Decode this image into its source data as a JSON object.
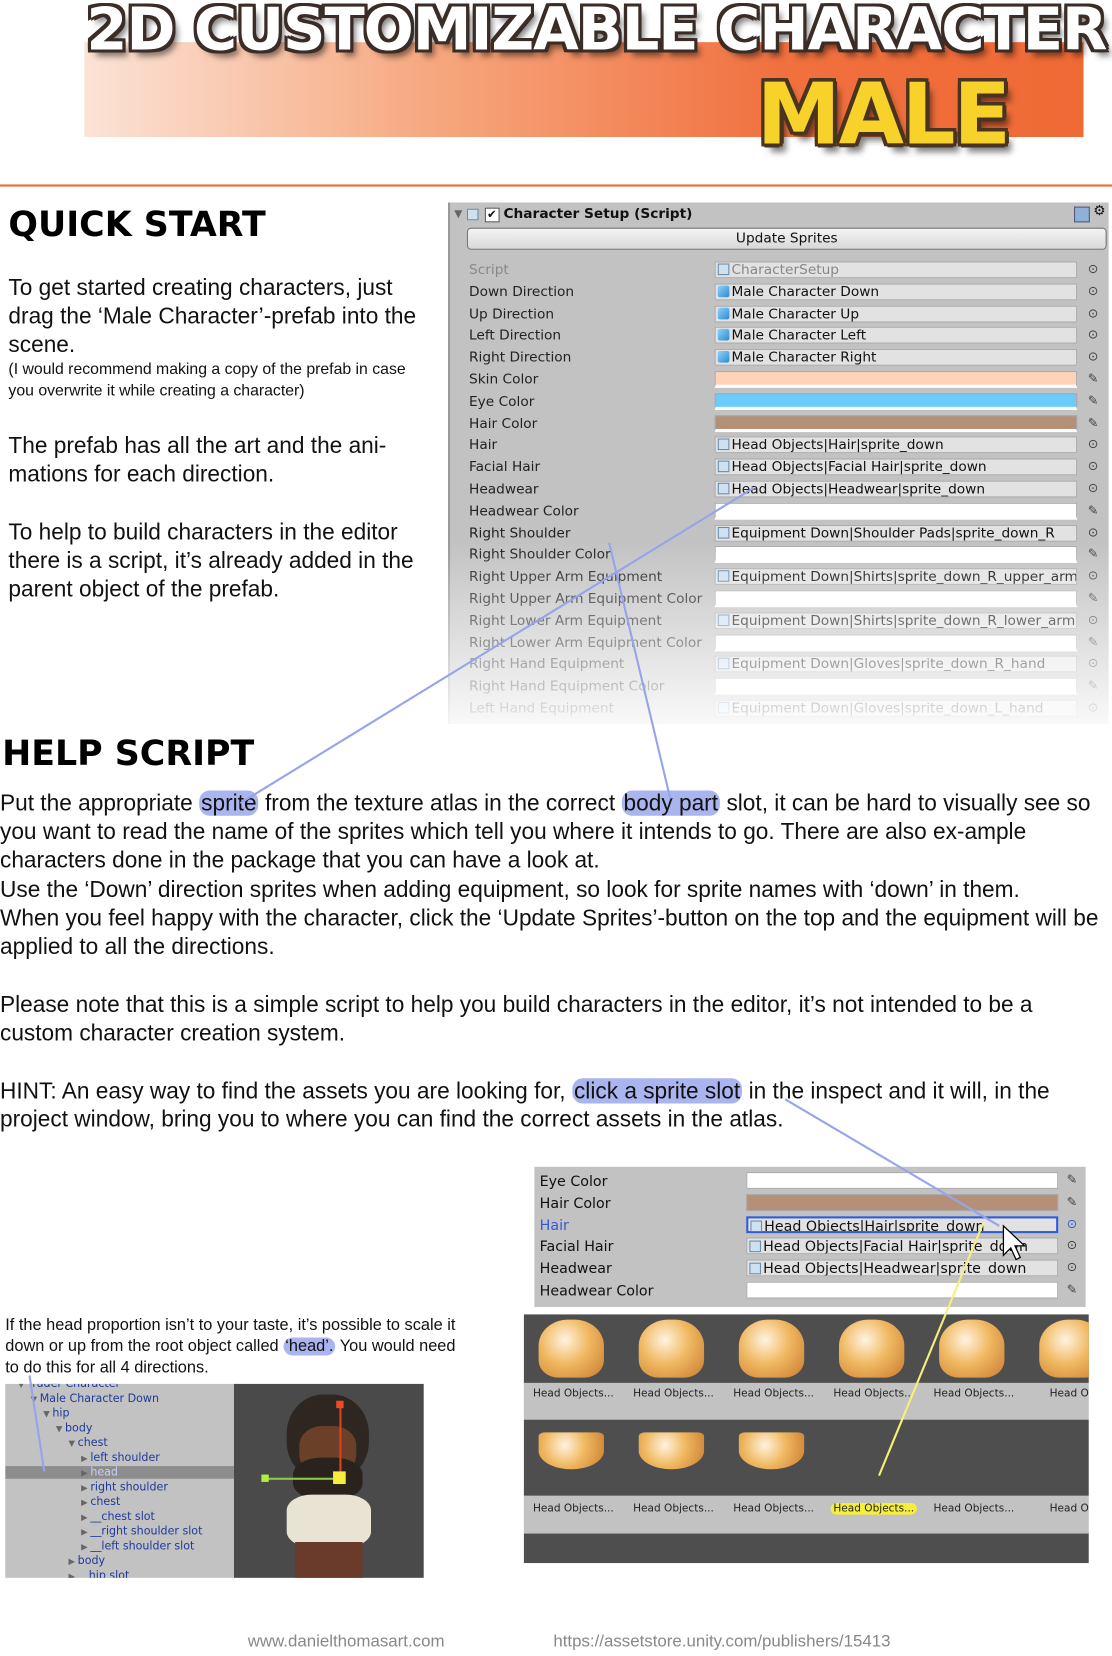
{
  "banner": {
    "title": "2D CUSTOMIZABLE CHARACTER",
    "subtitle": "MALE"
  },
  "quick_start": {
    "heading": "QUICK START",
    "p1": "To get started creating characters, just drag the ‘Male Character’-prefab into the scene.",
    "p1_note": "(I would recommend making a copy of the prefab in case you overwrite it while creating a character)",
    "p2": "The prefab has all the art and the ani-mations for each direction.",
    "p3": "To help to build characters in the editor there is a script, it’s already added in the parent object of the prefab."
  },
  "inspector": {
    "title": "Character Setup (Script)",
    "update_button": "Update Sprites",
    "colors": {
      "skin": "#ffd3b8",
      "eye": "#6bcbfc",
      "hair": "#b49078",
      "white": "#ffffff"
    },
    "rows": [
      {
        "label": "Script",
        "value": "CharacterSetup",
        "icon": "script-icon",
        "end": "⊙"
      },
      {
        "label": "Down Direction",
        "value": "Male Character Down",
        "icon": "prefab-icon",
        "end": "⊙"
      },
      {
        "label": "Up Direction",
        "value": "Male Character Up",
        "icon": "prefab-icon",
        "end": "⊙"
      },
      {
        "label": "Left Direction",
        "value": "Male Character Left",
        "icon": "prefab-icon",
        "end": "⊙"
      },
      {
        "label": "Right Direction",
        "value": "Male Character Right",
        "icon": "prefab-icon",
        "end": "⊙"
      },
      {
        "label": "Skin Color",
        "value": "",
        "color": "#ffd3b8",
        "end": "✎"
      },
      {
        "label": "Eye Color",
        "value": "",
        "color": "#6bcbfc",
        "end": "✎"
      },
      {
        "label": "Hair Color",
        "value": "",
        "color": "#b49078",
        "end": "✎"
      },
      {
        "label": "Hair",
        "value": "Head Objects|Hair|sprite_down",
        "icon": "sprite-icon",
        "end": "⊙"
      },
      {
        "label": "Facial Hair",
        "value": "Head Objects|Facial Hair|sprite_down",
        "icon": "sprite-icon",
        "end": "⊙"
      },
      {
        "label": "Headwear",
        "value": "Head Objects|Headwear|sprite_down",
        "icon": "sprite-icon",
        "end": "⊙"
      },
      {
        "label": "Headwear Color",
        "value": "",
        "color": "#ffffff",
        "end": "✎"
      },
      {
        "label": "Right Shoulder",
        "value": "Equipment Down|Shoulder Pads|sprite_down_R",
        "icon": "sprite-icon",
        "end": "⊙"
      },
      {
        "label": "Right Shoulder Color",
        "value": "",
        "color": "#ffffff",
        "end": "✎"
      },
      {
        "label": "Right Upper Arm Equipment",
        "value": "Equipment Down|Shirts|sprite_down_R_upper_arm",
        "icon": "sprite-icon",
        "end": "⊙"
      },
      {
        "label": "Right Upper Arm Equipment Color",
        "value": "",
        "color": "#ffffff",
        "end": "✎"
      },
      {
        "label": "Right Lower Arm Equipment",
        "value": "Equipment Down|Shirts|sprite_down_R_lower_arm",
        "icon": "sprite-icon",
        "end": "⊙"
      },
      {
        "label": "Right Lower Arm Equipment Color",
        "value": "",
        "color": "#ffffff",
        "end": "✎"
      },
      {
        "label": "Right Hand Equipment",
        "value": "Equipment Down|Gloves|sprite_down_R_hand",
        "icon": "sprite-icon",
        "end": "⊙"
      },
      {
        "label": "Right Hand Equipment Color",
        "value": "",
        "color": "#ffffff",
        "end": "✎"
      },
      {
        "label": "Left Hand Equipment",
        "value": "Equipment Down|Gloves|sprite_down_L_hand",
        "icon": "sprite-icon",
        "end": "⊙"
      }
    ]
  },
  "help_script": {
    "heading": "HELP SCRIPT",
    "p1_a": "Put the appropriate ",
    "p1_hl1": "sprite",
    "p1_b": " from the texture atlas in the correct ",
    "p1_hl2": "body part",
    "p1_c": " slot, it can be hard to visually see so you want to read the name of the sprites which tell you where it intends to go. There are also ex-ample characters done in the package that you can have a look at.",
    "p2": "Use the ‘Down’ direction sprites when adding equipment, so look for sprite names with ‘down’ in them.",
    "p3": "When you feel happy with the character, click the ‘Update Sprites’-button on the top and the equipment will be applied to all the directions.",
    "p4": "Please note that this is a simple script to help you build characters in the editor, it’s not intended to be a custom character creation system.",
    "hint_a": "HINT: An easy way to find the assets you are looking for, ",
    "hint_hl": "click a sprite slot",
    "hint_b": " in the inspect and it will, in the project window, bring you to where you can find the correct assets in the atlas."
  },
  "inspector_detail": {
    "rows": [
      {
        "label": "Eye Color",
        "value": "",
        "color": "#ffffff",
        "end": "✎"
      },
      {
        "label": "Hair Color",
        "value": "",
        "color": "#b49078",
        "end": "✎"
      },
      {
        "label": "Hair",
        "value": "Head Objects|Hair|sprite_down",
        "selected": true,
        "end": "⊙"
      },
      {
        "label": "Facial Hair",
        "value": "Head Objects|Facial Hair|sprite_down",
        "end": "⊙"
      },
      {
        "label": "Headwear",
        "value": "Head Objects|Headwear|sprite_down",
        "end": "⊙"
      },
      {
        "label": "Headwear Color",
        "value": "",
        "color": "#ffffff",
        "end": "✎"
      }
    ],
    "selected_color": "#2f5bd6"
  },
  "asset_grid": {
    "row1": [
      "Head Objects...",
      "Head Objects...",
      "Head Objects...",
      "Head Objects...",
      "Head Objects...",
      "Head Obj"
    ],
    "row2": [
      "Head Objects...",
      "Head Objects...",
      "Head Objects...",
      "Head Objects...",
      "Head Objects...",
      "Head Obj"
    ],
    "highlight_index": 3,
    "highlight_color": "#f5ee3a"
  },
  "head_note": {
    "text_a": "If the head proportion isn’t  to your taste, it’s possible to scale it down or up from the root object called ",
    "text_hl": "‘head’.",
    "text_b": " You would need to do this for all 4 directions."
  },
  "hierarchy": [
    {
      "label": "Trader Character",
      "depth": 0,
      "arrow": "▼"
    },
    {
      "label": "Male Character Down",
      "depth": 1,
      "arrow": "▼"
    },
    {
      "label": "hip",
      "depth": 2,
      "arrow": "▼"
    },
    {
      "label": "body",
      "depth": 3,
      "arrow": "▼"
    },
    {
      "label": "chest",
      "depth": 4,
      "arrow": "▼"
    },
    {
      "label": "left shoulder",
      "depth": 5,
      "arrow": "▶"
    },
    {
      "label": "head",
      "depth": 5,
      "arrow": "▶",
      "selected": true
    },
    {
      "label": "right shoulder",
      "depth": 5,
      "arrow": "▶"
    },
    {
      "label": "chest",
      "depth": 5,
      "arrow": "▶"
    },
    {
      "label": "__chest slot",
      "depth": 5,
      "arrow": "▶"
    },
    {
      "label": "__right shoulder slot",
      "depth": 5,
      "arrow": "▶"
    },
    {
      "label": "__left shoulder slot",
      "depth": 5,
      "arrow": "▶"
    },
    {
      "label": "body",
      "depth": 4,
      "arrow": "▶"
    },
    {
      "label": "__hip slot",
      "depth": 4,
      "arrow": "▶"
    }
  ],
  "footer": {
    "left": "www.danielthomasart.com",
    "right": "https://assetstore.unity.com/publishers/15413"
  }
}
